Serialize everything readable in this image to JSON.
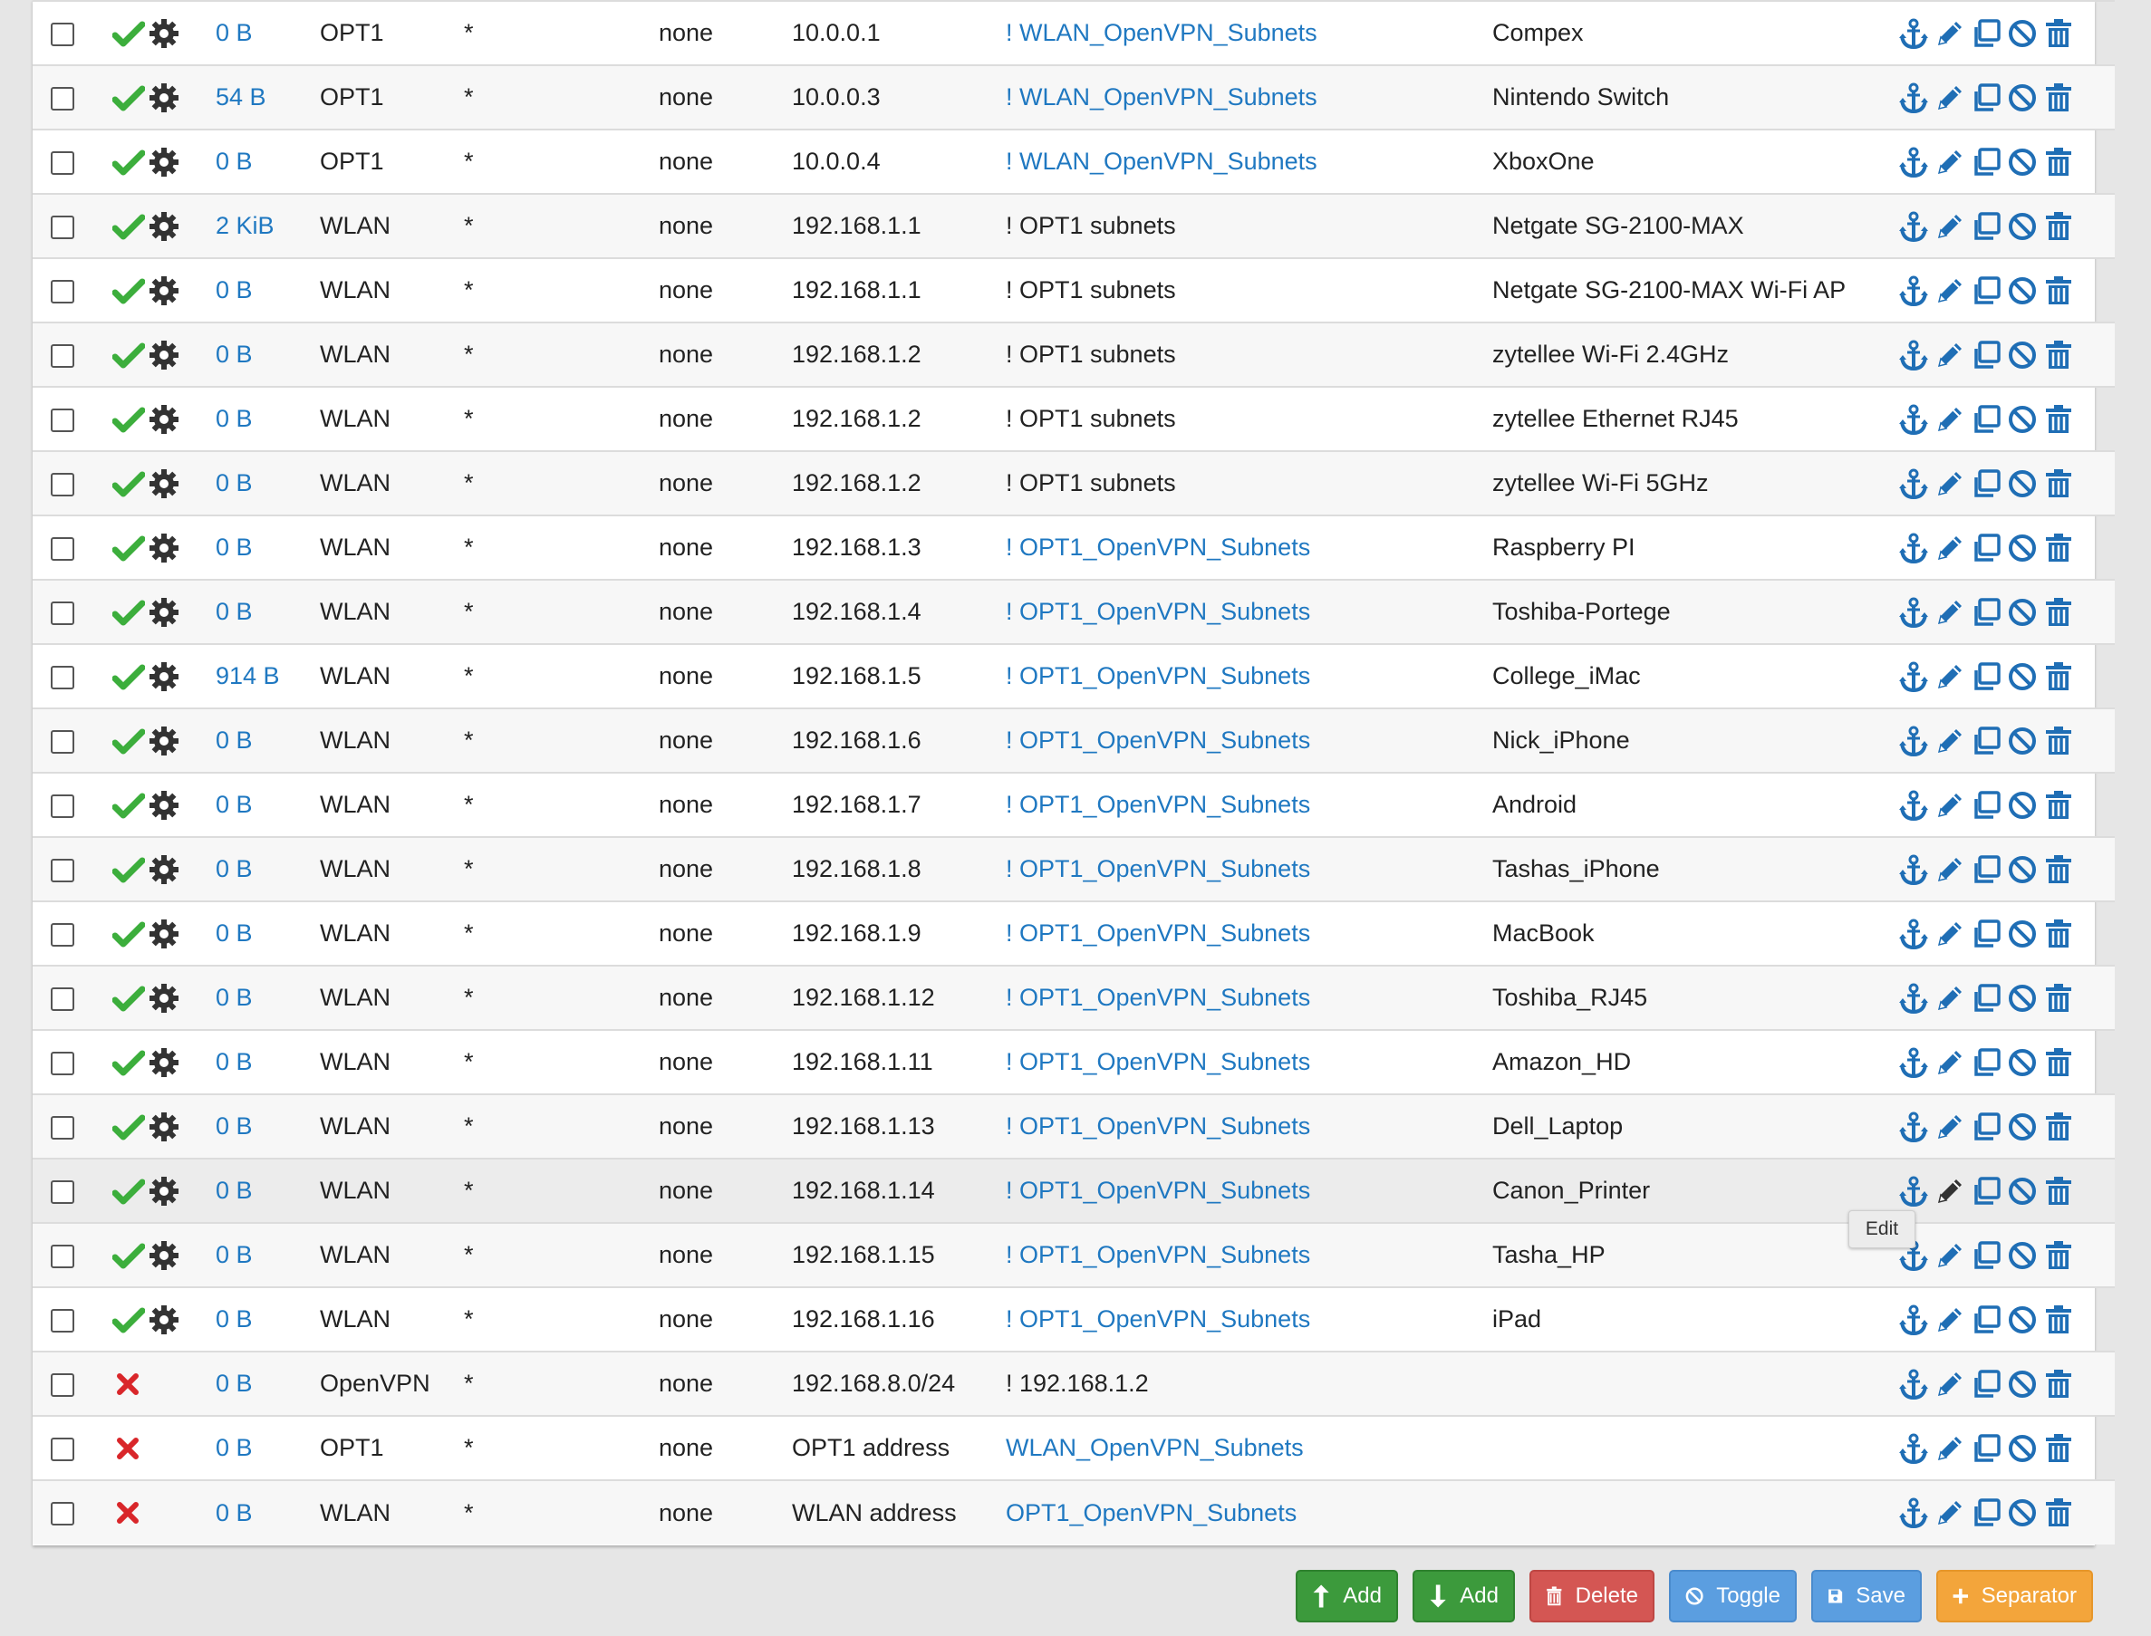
{
  "colors": {
    "link": "#1f78c1",
    "pass": "#3cae3c",
    "block": "#d9262a",
    "action_icon": "#1f6eb5"
  },
  "rules": [
    {
      "status": "pass",
      "states": "0 B",
      "interface": "OPT1",
      "source": "*",
      "port": "none",
      "destination": "10.0.0.1",
      "dest_port": "! WLAN_OpenVPN_Subnets",
      "dest_port_link": true,
      "description": "Compex"
    },
    {
      "status": "pass",
      "states": "54 B",
      "interface": "OPT1",
      "source": "*",
      "port": "none",
      "destination": "10.0.0.3",
      "dest_port": "! WLAN_OpenVPN_Subnets",
      "dest_port_link": true,
      "description": "Nintendo Switch"
    },
    {
      "status": "pass",
      "states": "0 B",
      "interface": "OPT1",
      "source": "*",
      "port": "none",
      "destination": "10.0.0.4",
      "dest_port": "! WLAN_OpenVPN_Subnets",
      "dest_port_link": true,
      "description": "XboxOne"
    },
    {
      "status": "pass",
      "states": "2 KiB",
      "interface": "WLAN",
      "source": "*",
      "port": "none",
      "destination": "192.168.1.1",
      "dest_port": "! OPT1 subnets",
      "dest_port_link": false,
      "description": "Netgate SG-2100-MAX"
    },
    {
      "status": "pass",
      "states": "0 B",
      "interface": "WLAN",
      "source": "*",
      "port": "none",
      "destination": "192.168.1.1",
      "dest_port": "! OPT1 subnets",
      "dest_port_link": false,
      "description": "Netgate SG-2100-MAX Wi-Fi AP"
    },
    {
      "status": "pass",
      "states": "0 B",
      "interface": "WLAN",
      "source": "*",
      "port": "none",
      "destination": "192.168.1.2",
      "dest_port": "! OPT1 subnets",
      "dest_port_link": false,
      "description": "zytellee Wi-Fi 2.4GHz"
    },
    {
      "status": "pass",
      "states": "0 B",
      "interface": "WLAN",
      "source": "*",
      "port": "none",
      "destination": "192.168.1.2",
      "dest_port": "! OPT1 subnets",
      "dest_port_link": false,
      "description": "zytellee Ethernet RJ45"
    },
    {
      "status": "pass",
      "states": "0 B",
      "interface": "WLAN",
      "source": "*",
      "port": "none",
      "destination": "192.168.1.2",
      "dest_port": "! OPT1 subnets",
      "dest_port_link": false,
      "description": "zytellee Wi-Fi 5GHz"
    },
    {
      "status": "pass",
      "states": "0 B",
      "interface": "WLAN",
      "source": "*",
      "port": "none",
      "destination": "192.168.1.3",
      "dest_port": "! OPT1_OpenVPN_Subnets",
      "dest_port_link": true,
      "description": "Raspberry PI"
    },
    {
      "status": "pass",
      "states": "0 B",
      "interface": "WLAN",
      "source": "*",
      "port": "none",
      "destination": "192.168.1.4",
      "dest_port": "! OPT1_OpenVPN_Subnets",
      "dest_port_link": true,
      "description": "Toshiba-Portege"
    },
    {
      "status": "pass",
      "states": "914 B",
      "interface": "WLAN",
      "source": "*",
      "port": "none",
      "destination": "192.168.1.5",
      "dest_port": "! OPT1_OpenVPN_Subnets",
      "dest_port_link": true,
      "description": "College_iMac"
    },
    {
      "status": "pass",
      "states": "0 B",
      "interface": "WLAN",
      "source": "*",
      "port": "none",
      "destination": "192.168.1.6",
      "dest_port": "! OPT1_OpenVPN_Subnets",
      "dest_port_link": true,
      "description": "Nick_iPhone"
    },
    {
      "status": "pass",
      "states": "0 B",
      "interface": "WLAN",
      "source": "*",
      "port": "none",
      "destination": "192.168.1.7",
      "dest_port": "! OPT1_OpenVPN_Subnets",
      "dest_port_link": true,
      "description": "Android"
    },
    {
      "status": "pass",
      "states": "0 B",
      "interface": "WLAN",
      "source": "*",
      "port": "none",
      "destination": "192.168.1.8",
      "dest_port": "! OPT1_OpenVPN_Subnets",
      "dest_port_link": true,
      "description": "Tashas_iPhone"
    },
    {
      "status": "pass",
      "states": "0 B",
      "interface": "WLAN",
      "source": "*",
      "port": "none",
      "destination": "192.168.1.9",
      "dest_port": "! OPT1_OpenVPN_Subnets",
      "dest_port_link": true,
      "description": "MacBook"
    },
    {
      "status": "pass",
      "states": "0 B",
      "interface": "WLAN",
      "source": "*",
      "port": "none",
      "destination": "192.168.1.12",
      "dest_port": "! OPT1_OpenVPN_Subnets",
      "dest_port_link": true,
      "description": "Toshiba_RJ45"
    },
    {
      "status": "pass",
      "states": "0 B",
      "interface": "WLAN",
      "source": "*",
      "port": "none",
      "destination": "192.168.1.11",
      "dest_port": "! OPT1_OpenVPN_Subnets",
      "dest_port_link": true,
      "description": "Amazon_HD"
    },
    {
      "status": "pass",
      "states": "0 B",
      "interface": "WLAN",
      "source": "*",
      "port": "none",
      "destination": "192.168.1.13",
      "dest_port": "! OPT1_OpenVPN_Subnets",
      "dest_port_link": true,
      "description": "Dell_Laptop"
    },
    {
      "status": "pass",
      "states": "0 B",
      "interface": "WLAN",
      "source": "*",
      "port": "none",
      "destination": "192.168.1.14",
      "dest_port": "! OPT1_OpenVPN_Subnets",
      "dest_port_link": true,
      "description": "Canon_Printer",
      "hover": true
    },
    {
      "status": "pass",
      "states": "0 B",
      "interface": "WLAN",
      "source": "*",
      "port": "none",
      "destination": "192.168.1.15",
      "dest_port": "! OPT1_OpenVPN_Subnets",
      "dest_port_link": true,
      "description": "Tasha_HP"
    },
    {
      "status": "pass",
      "states": "0 B",
      "interface": "WLAN",
      "source": "*",
      "port": "none",
      "destination": "192.168.1.16",
      "dest_port": "! OPT1_OpenVPN_Subnets",
      "dest_port_link": true,
      "description": "iPad"
    },
    {
      "status": "block",
      "states": "0 B",
      "interface": "OpenVPN",
      "source": "*",
      "port": "none",
      "destination": "192.168.8.0/24",
      "dest_port": "! 192.168.1.2",
      "dest_port_link": false,
      "description": ""
    },
    {
      "status": "block",
      "states": "0 B",
      "interface": "OPT1",
      "source": "*",
      "port": "none",
      "destination": "OPT1 address",
      "dest_port": "WLAN_OpenVPN_Subnets",
      "dest_port_link": true,
      "description": ""
    },
    {
      "status": "block",
      "states": "0 B",
      "interface": "WLAN",
      "source": "*",
      "port": "none",
      "destination": "WLAN address",
      "dest_port": "OPT1_OpenVPN_Subnets",
      "dest_port_link": true,
      "description": ""
    }
  ],
  "row_action_icons": [
    "anchor-icon",
    "pencil-icon",
    "copy-icon",
    "disable-icon",
    "trash-icon"
  ],
  "tooltip": {
    "text": "Edit"
  },
  "buttons": {
    "add_top": "Add",
    "add_bottom": "Add",
    "delete": "Delete",
    "toggle": "Toggle",
    "save": "Save",
    "separator": "Separator"
  }
}
